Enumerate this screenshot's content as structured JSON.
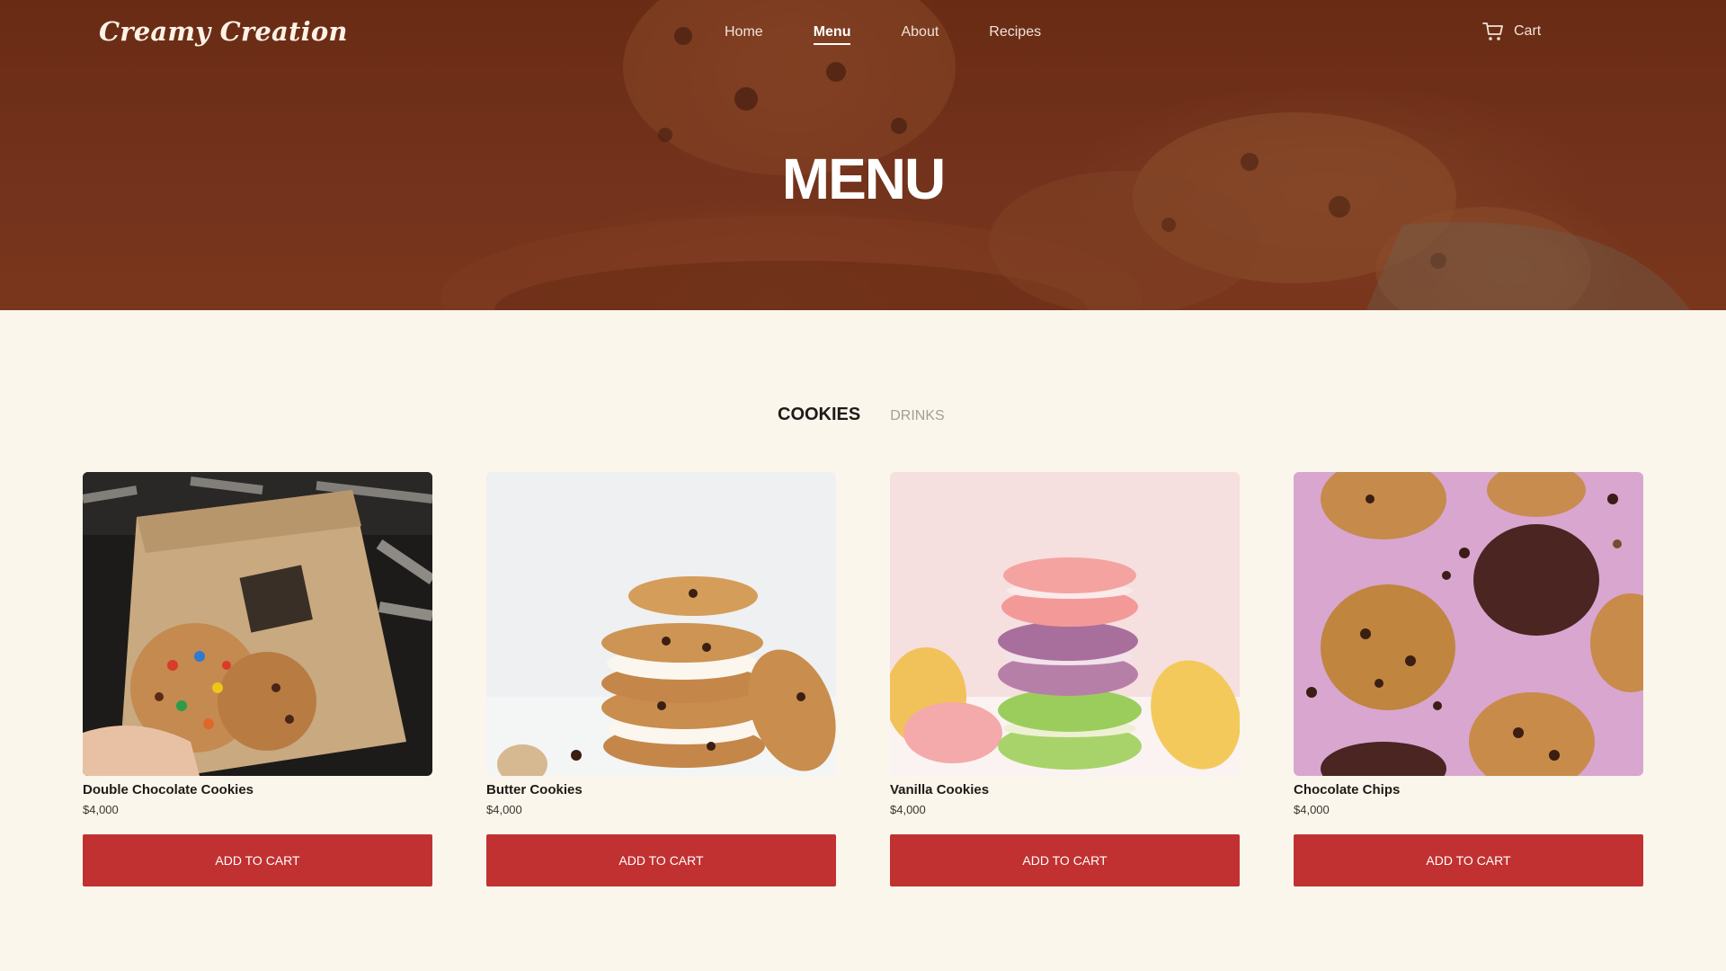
{
  "brand": "Creamy Creation",
  "nav": [
    {
      "label": "Home",
      "active": false
    },
    {
      "label": "Menu",
      "active": true
    },
    {
      "label": "About",
      "active": false
    },
    {
      "label": "Recipes",
      "active": false
    }
  ],
  "cart": {
    "label": "Cart",
    "icon": "cart-icon"
  },
  "hero": {
    "title": "MENU"
  },
  "tabs": [
    {
      "label": "COOKIES",
      "active": true
    },
    {
      "label": "DRINKS",
      "active": false
    }
  ],
  "products": [
    {
      "name": "Double Chocolate Cookies",
      "price": "$4,000",
      "button": "ADD TO CART"
    },
    {
      "name": "Butter Cookies",
      "price": "$4,000",
      "button": "ADD TO CART"
    },
    {
      "name": "Vanilla Cookies",
      "price": "$4,000",
      "button": "ADD TO CART"
    },
    {
      "name": "Chocolate Chips",
      "price": "$4,000",
      "button": "ADD TO CART"
    }
  ],
  "colors": {
    "hero_brown": "#7a3720",
    "page_cream": "#fbf6ec",
    "button_red": "#c13131"
  }
}
